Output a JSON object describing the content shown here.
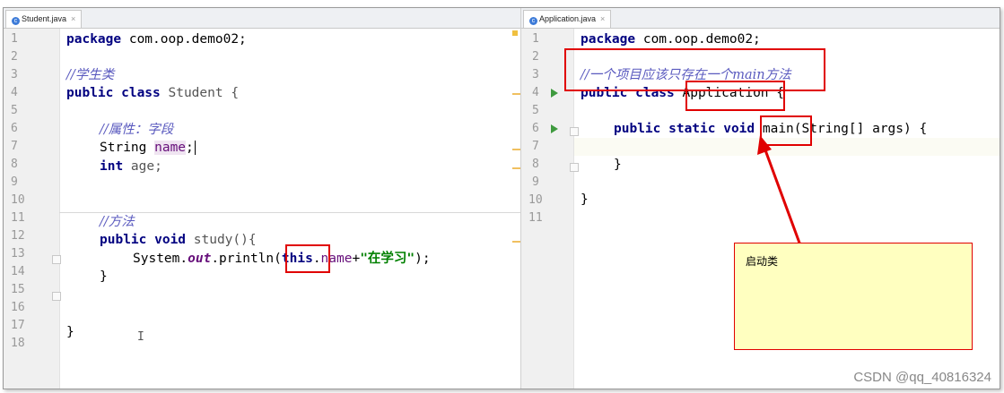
{
  "left_editor": {
    "tab": {
      "label": "Student.java",
      "close": "×",
      "icon": "java-class-icon"
    },
    "line_numbers": [
      "1",
      "2",
      "3",
      "4",
      "5",
      "6",
      "7",
      "8",
      "9",
      "10",
      "11",
      "12",
      "13",
      "14",
      "15",
      "16",
      "17",
      "18"
    ],
    "lines": {
      "l1": {
        "kw": "package",
        "rest": " com.oop.demo02;"
      },
      "l3": {
        "comment": "//学生类"
      },
      "l4": {
        "kw": "public class",
        "rest": " Student {"
      },
      "l6": {
        "comment": "//属性：字段"
      },
      "l7": {
        "type": "String ",
        "field": "name",
        "rest": ";"
      },
      "l8": {
        "kw": "int",
        "rest": " age;"
      },
      "l11": {
        "comment": "//方法"
      },
      "l12": {
        "kw": "public void",
        "rest": " study(){"
      },
      "l13": {
        "a": "System.",
        "b": "out",
        "c": ".println(",
        "kw": "this",
        "d": ".",
        "e": "name",
        "f": "+",
        "str": "\"在学习\"",
        "g": ");"
      },
      "l14": {
        "text": "}"
      },
      "l17": {
        "text": "}"
      }
    }
  },
  "right_editor": {
    "tab": {
      "label": "Application.java",
      "close": "×",
      "icon": "java-class-icon"
    },
    "line_numbers": [
      "1",
      "2",
      "3",
      "4",
      "5",
      "6",
      "7",
      "8",
      "9",
      "10",
      "11"
    ],
    "lines": {
      "l1": {
        "kw": "package",
        "rest": " com.oop.demo02;"
      },
      "l3": {
        "comment": "//一个项目应该只存在一个main方法"
      },
      "l4": {
        "kw": "public class",
        "rest": " Application {"
      },
      "l6": {
        "kw": "public static void",
        "rest": " main(String[] args) {"
      },
      "l8": {
        "text": "}"
      },
      "l10": {
        "text": "}"
      }
    }
  },
  "annotation": {
    "text": "启动类",
    "color": "#e00000",
    "background": "#ffffc0"
  },
  "watermark": "CSDN @qq_40816324",
  "colors": {
    "keyword": "#000080",
    "comment": "#5a5abf",
    "field": "#660e7a",
    "string": "#008000",
    "highlight": "#e00000"
  }
}
